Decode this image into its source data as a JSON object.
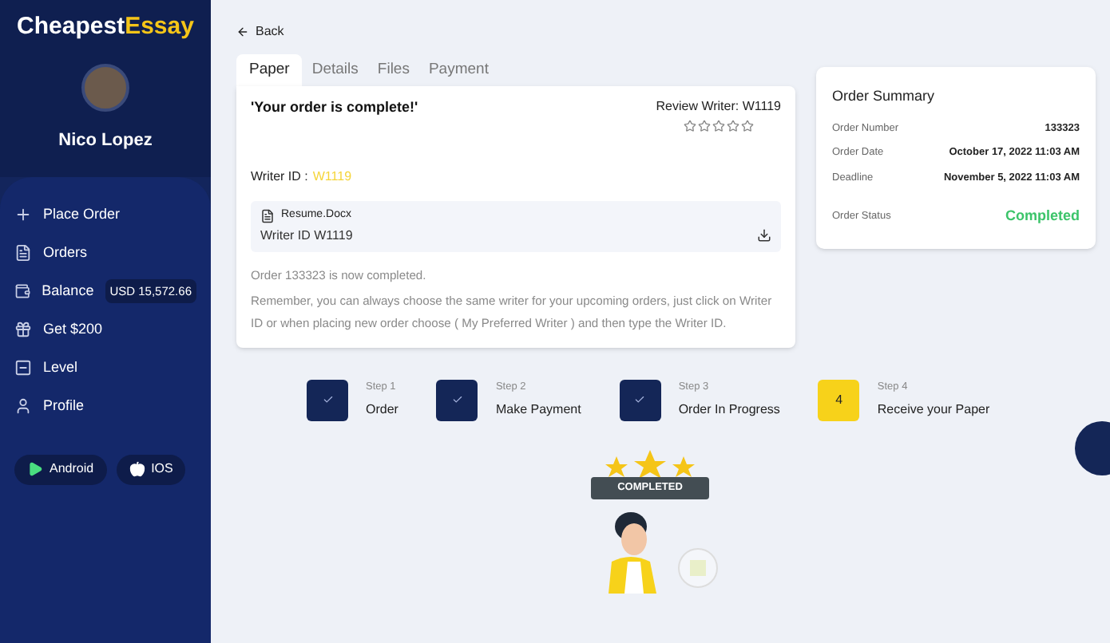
{
  "brand": {
    "first": "Cheapest",
    "second": "Essay"
  },
  "user": {
    "name": "Nico Lopez"
  },
  "nav": [
    {
      "kind": "plus",
      "label": "Place Order"
    },
    {
      "kind": "orders",
      "label": "Orders"
    },
    {
      "kind": "wallet",
      "label": "Balance",
      "badge": "USD 15,572.66"
    },
    {
      "kind": "gift",
      "label": "Get $200"
    },
    {
      "kind": "level",
      "label": "Level"
    },
    {
      "kind": "user",
      "label": "Profile"
    }
  ],
  "stores": [
    {
      "kind": "android",
      "label": "Android"
    },
    {
      "kind": "ios",
      "label": "IOS"
    }
  ],
  "back": "Back",
  "tabs": [
    {
      "label": "Paper",
      "selected": true
    },
    {
      "label": "Details",
      "selected": false
    },
    {
      "label": "Files",
      "selected": false
    },
    {
      "label": "Payment",
      "selected": false
    }
  ],
  "paper": {
    "title": "'Your order is complete!'",
    "review": "Review Writer: W1119",
    "stars": 0,
    "writer_label": "Writer ID :",
    "writer_id": "W1119",
    "file": {
      "name": "Resume.Docx",
      "writer": "Writer ID W1119"
    },
    "messages": [
      "Order 133323 is now completed.",
      "Remember, you can always choose the same writer for your upcoming orders, just click on Writer ID or when placing new order choose ( My Preferred Writer ) and then type the Writer ID."
    ]
  },
  "summary": {
    "title": "Order Summary",
    "rows": [
      {
        "label": "Order Number",
        "value": "133323"
      },
      {
        "label": "Order Date",
        "value": "October 17, 2022 11:03 AM"
      },
      {
        "label": "Deadline",
        "value": "November 5, 2022 11:03 AM"
      }
    ],
    "status": {
      "label": "Order Status",
      "value": "Completed"
    }
  },
  "steps": [
    {
      "step": "Step 1",
      "label": "Order",
      "done": true
    },
    {
      "step": "Step 2",
      "label": "Make Payment",
      "done": true
    },
    {
      "step": "Step 3",
      "label": "Order In Progress",
      "done": true
    },
    {
      "step": "Step 4",
      "label": "Receive your Paper",
      "done": false,
      "number": "4"
    }
  ],
  "illustration": {
    "banner": "COMPLETED"
  }
}
